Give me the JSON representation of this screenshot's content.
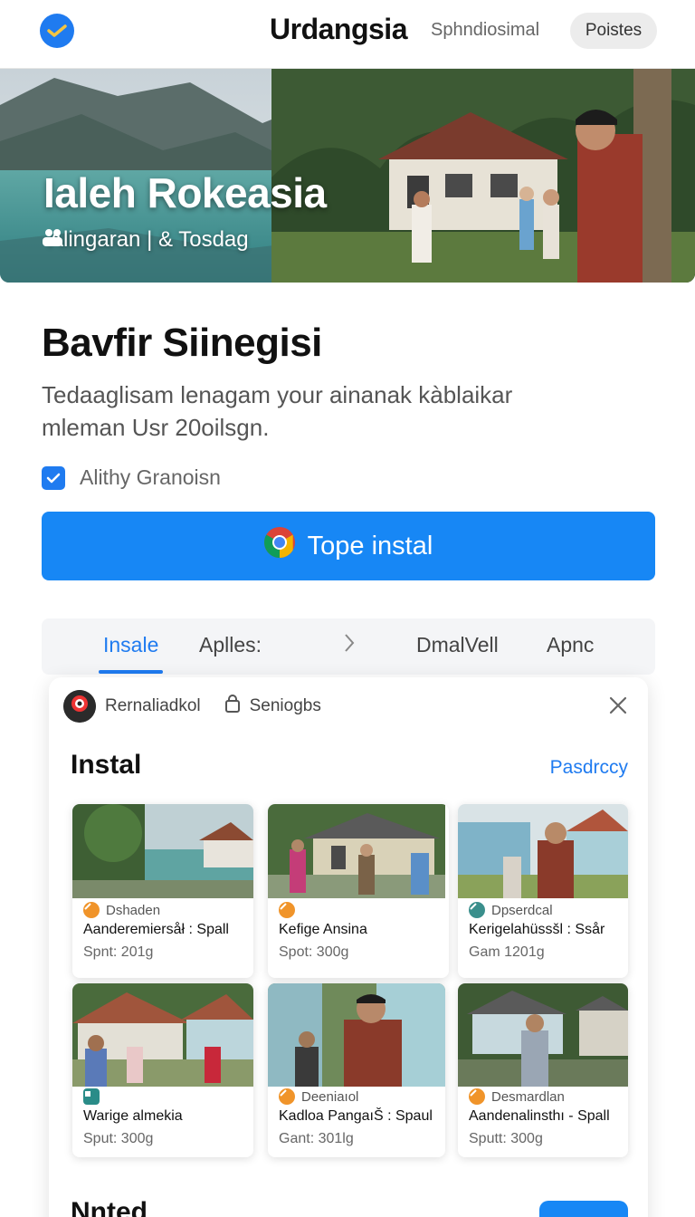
{
  "header": {
    "title": "Urdangsia",
    "nav_link": "Sphndiosimal",
    "nav_pill": "Poistes"
  },
  "hero": {
    "title": "Ialeh Rokeasia",
    "subtitle": "Alingaran | & Tosdag"
  },
  "main": {
    "headline": "Bavfir Siinegisi",
    "description": "Tedaaglisam lenagam your ainanak kàblaikar mleman Usr 20oilsgn.",
    "checkbox_label": "Alithy Granoisn",
    "checkbox_checked": true,
    "cta_label": "Tope instal"
  },
  "tabs": [
    {
      "label": "Insale",
      "active": true
    },
    {
      "label": "Aplles:",
      "active": false
    },
    {
      "label": "DmalVell",
      "active": false
    },
    {
      "label": "Apnc",
      "active": false
    }
  ],
  "panel": {
    "top_user": "Rernaliadkol",
    "top_settings": "Seniogbs",
    "title": "Instal",
    "link": "Pasdrccy",
    "cards": [
      {
        "tag": "Dshaden",
        "tag_color": "#f0942a",
        "title": "Aanderemiersåł : Spall",
        "meta": "Spnt: 201g"
      },
      {
        "tag": "",
        "tag_color": "#f0942a",
        "title": "Kefige Ansina",
        "meta": "Spot: 300g"
      },
      {
        "tag": "Dpserdcal",
        "tag_color": "#3a8f8c",
        "title": "Kerigelahüssšl : Ssår",
        "meta": "Gam 1201g"
      },
      {
        "tag": "",
        "tag_color": "#2a8c88",
        "title": "Warige almekia",
        "meta": "Sput: 300g"
      },
      {
        "tag": "Deeniaıol",
        "tag_color": "#f0942a",
        "title": "Kadloa PangaıŠ : Spaul",
        "meta": "Gant: 301lg"
      },
      {
        "tag": "Desmardlan",
        "tag_color": "#f0942a",
        "title": "Aandenalinsthı - Spall",
        "meta": "Sputt: 300g"
      }
    ],
    "bottom_heading": "Nnted"
  },
  "colors": {
    "accent": "#1f7bf0",
    "cta": "#1787f5",
    "tag_orange": "#f0942a",
    "tag_teal": "#3a8f8c"
  }
}
